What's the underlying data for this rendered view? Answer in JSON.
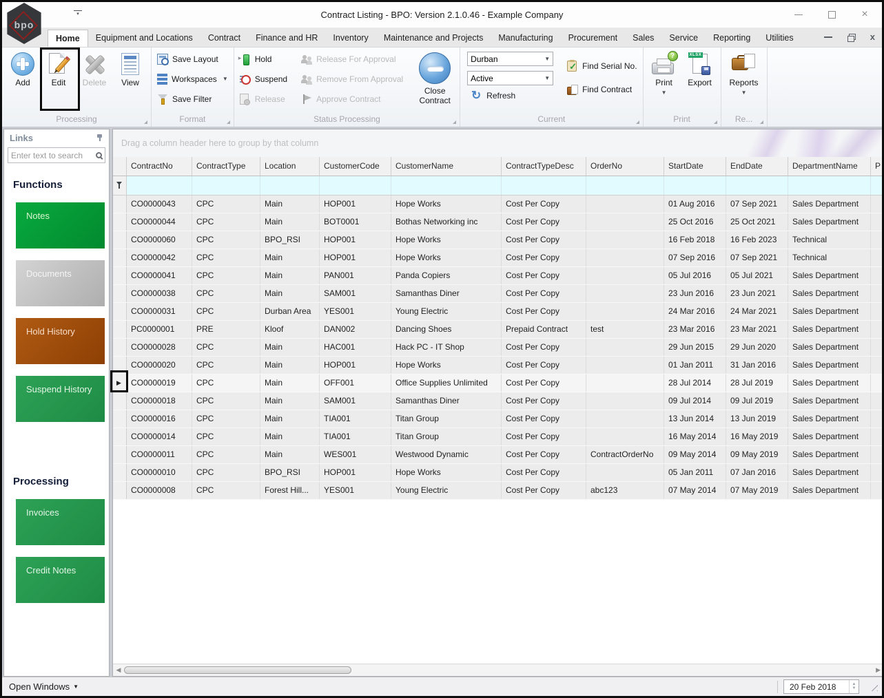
{
  "window": {
    "title": "Contract Listing - BPO: Version 2.1.0.46 - Example Company",
    "logo_text": "bpo"
  },
  "tabs": {
    "items": [
      {
        "label": "Home",
        "active": true
      },
      {
        "label": "Equipment and Locations",
        "active": false
      },
      {
        "label": "Contract",
        "active": false
      },
      {
        "label": "Finance and HR",
        "active": false
      },
      {
        "label": "Inventory",
        "active": false
      },
      {
        "label": "Maintenance and Projects",
        "active": false
      },
      {
        "label": "Manufacturing",
        "active": false
      },
      {
        "label": "Procurement",
        "active": false
      },
      {
        "label": "Sales",
        "active": false
      },
      {
        "label": "Service",
        "active": false
      },
      {
        "label": "Reporting",
        "active": false
      },
      {
        "label": "Utilities",
        "active": false
      }
    ]
  },
  "ribbon": {
    "processing": {
      "label": "Processing",
      "add": "Add",
      "edit": "Edit",
      "delete": "Delete",
      "view": "View"
    },
    "format": {
      "label": "Format",
      "save_layout": "Save Layout",
      "workspaces": "Workspaces",
      "save_filter": "Save Filter"
    },
    "status_processing": {
      "label": "Status Processing",
      "hold": "Hold",
      "suspend": "Suspend",
      "release": "Release",
      "release_for_approval": "Release For Approval",
      "remove_from_approval": "Remove From Approval",
      "approve_contract": "Approve Contract",
      "close_contract": "Close Contract"
    },
    "current": {
      "label": "Current",
      "site_selected": "Durban",
      "status_selected": "Active",
      "refresh": "Refresh",
      "find_serial": "Find Serial No.",
      "find_contract": "Find Contract"
    },
    "print": {
      "label": "Print",
      "print": "Print",
      "export": "Export"
    },
    "reports": {
      "label": "Re...",
      "reports": "Reports"
    }
  },
  "sidebar": {
    "title": "Links",
    "search_placeholder": "Enter text to search",
    "sections": [
      {
        "heading": "Functions",
        "buttons": [
          {
            "label": "Notes",
            "style": "green"
          },
          {
            "label": "Documents",
            "style": "gray"
          },
          {
            "label": "Hold History",
            "style": "rust"
          },
          {
            "label": "Suspend History",
            "style": "green2"
          }
        ]
      },
      {
        "heading": "Processing",
        "buttons": [
          {
            "label": "Invoices",
            "style": "green2"
          },
          {
            "label": "Credit Notes",
            "style": "green2"
          }
        ]
      }
    ]
  },
  "grid": {
    "group_hint": "Drag a column header here to group by that column",
    "focused_contract": "CO0000019",
    "columns": [
      {
        "key": "contract_no",
        "label": "ContractNo"
      },
      {
        "key": "contract_type",
        "label": "ContractType"
      },
      {
        "key": "location",
        "label": "Location"
      },
      {
        "key": "customer_code",
        "label": "CustomerCode"
      },
      {
        "key": "customer_name",
        "label": "CustomerName"
      },
      {
        "key": "contract_type_desc",
        "label": "ContractTypeDesc"
      },
      {
        "key": "order_no",
        "label": "OrderNo"
      },
      {
        "key": "start_date",
        "label": "StartDate"
      },
      {
        "key": "end_date",
        "label": "EndDate"
      },
      {
        "key": "department_name",
        "label": "DepartmentName"
      },
      {
        "key": "partial",
        "label": "P"
      }
    ],
    "rows": [
      {
        "contract_no": "CO0000043",
        "contract_type": "CPC",
        "location": "Main",
        "customer_code": "HOP001",
        "customer_name": "Hope Works",
        "contract_type_desc": "Cost Per Copy",
        "order_no": "",
        "start_date": "01 Aug 2016",
        "end_date": "07 Sep 2021",
        "department_name": "Sales Department"
      },
      {
        "contract_no": "CO0000044",
        "contract_type": "CPC",
        "location": "Main",
        "customer_code": "BOT0001",
        "customer_name": "Bothas Networking inc",
        "contract_type_desc": "Cost Per Copy",
        "order_no": "",
        "start_date": "25 Oct 2016",
        "end_date": "25 Oct 2021",
        "department_name": "Sales Department"
      },
      {
        "contract_no": "CO0000060",
        "contract_type": "CPC",
        "location": "BPO_RSI",
        "customer_code": "HOP001",
        "customer_name": "Hope Works",
        "contract_type_desc": "Cost Per Copy",
        "order_no": "",
        "start_date": "16 Feb 2018",
        "end_date": "16 Feb 2023",
        "department_name": "Technical"
      },
      {
        "contract_no": "CO0000042",
        "contract_type": "CPC",
        "location": "Main",
        "customer_code": "HOP001",
        "customer_name": "Hope Works",
        "contract_type_desc": "Cost Per Copy",
        "order_no": "",
        "start_date": "07 Sep 2016",
        "end_date": "07 Sep 2021",
        "department_name": "Technical"
      },
      {
        "contract_no": "CO0000041",
        "contract_type": "CPC",
        "location": "Main",
        "customer_code": "PAN001",
        "customer_name": "Panda Copiers",
        "contract_type_desc": "Cost Per Copy",
        "order_no": "",
        "start_date": "05 Jul 2016",
        "end_date": "05 Jul 2021",
        "department_name": "Sales Department"
      },
      {
        "contract_no": "CO0000038",
        "contract_type": "CPC",
        "location": "Main",
        "customer_code": "SAM001",
        "customer_name": "Samanthas Diner",
        "contract_type_desc": "Cost Per Copy",
        "order_no": "",
        "start_date": "23 Jun 2016",
        "end_date": "23 Jun 2021",
        "department_name": "Sales Department"
      },
      {
        "contract_no": "CO0000031",
        "contract_type": "CPC",
        "location": "Durban Area",
        "customer_code": "YES001",
        "customer_name": "Young Electric",
        "contract_type_desc": "Cost Per Copy",
        "order_no": "",
        "start_date": "24 Mar 2016",
        "end_date": "24 Mar 2021",
        "department_name": "Sales Department"
      },
      {
        "contract_no": "PC0000001",
        "contract_type": "PRE",
        "location": "Kloof",
        "customer_code": "DAN002",
        "customer_name": "Dancing Shoes",
        "contract_type_desc": "Prepaid Contract",
        "order_no": "test",
        "start_date": "23 Mar 2016",
        "end_date": "23 Mar 2021",
        "department_name": "Sales Department"
      },
      {
        "contract_no": "CO0000028",
        "contract_type": "CPC",
        "location": "Main",
        "customer_code": "HAC001",
        "customer_name": "Hack PC - IT Shop",
        "contract_type_desc": "Cost Per Copy",
        "order_no": "",
        "start_date": "29 Jun 2015",
        "end_date": "29 Jun 2020",
        "department_name": "Sales Department"
      },
      {
        "contract_no": "CO0000020",
        "contract_type": "CPC",
        "location": "Main",
        "customer_code": "HOP001",
        "customer_name": "Hope Works",
        "contract_type_desc": "Cost Per Copy",
        "order_no": "",
        "start_date": "01 Jan 2011",
        "end_date": "31 Jan 2016",
        "department_name": "Sales Department"
      },
      {
        "contract_no": "CO0000019",
        "contract_type": "CPC",
        "location": "Main",
        "customer_code": "OFF001",
        "customer_name": "Office Supplies Unlimited",
        "contract_type_desc": "Cost Per Copy",
        "order_no": "",
        "start_date": "28 Jul 2014",
        "end_date": "28 Jul 2019",
        "department_name": "Sales Department"
      },
      {
        "contract_no": "CO0000018",
        "contract_type": "CPC",
        "location": "Main",
        "customer_code": "SAM001",
        "customer_name": "Samanthas Diner",
        "contract_type_desc": "Cost Per Copy",
        "order_no": "",
        "start_date": "09 Jul 2014",
        "end_date": "09 Jul 2019",
        "department_name": "Sales Department"
      },
      {
        "contract_no": "CO0000016",
        "contract_type": "CPC",
        "location": "Main",
        "customer_code": "TIA001",
        "customer_name": "Titan Group",
        "contract_type_desc": "Cost Per Copy",
        "order_no": "",
        "start_date": "13 Jun 2014",
        "end_date": "13 Jun 2019",
        "department_name": "Sales Department"
      },
      {
        "contract_no": "CO0000014",
        "contract_type": "CPC",
        "location": "Main",
        "customer_code": "TIA001",
        "customer_name": "Titan Group",
        "contract_type_desc": "Cost Per Copy",
        "order_no": "",
        "start_date": "16 May 2014",
        "end_date": "16 May 2019",
        "department_name": "Sales Department"
      },
      {
        "contract_no": "CO0000011",
        "contract_type": "CPC",
        "location": "Main",
        "customer_code": "WES001",
        "customer_name": "Westwood Dynamic",
        "contract_type_desc": "Cost Per Copy",
        "order_no": "ContractOrderNo",
        "start_date": "09 May 2014",
        "end_date": "09 May 2019",
        "department_name": "Sales Department"
      },
      {
        "contract_no": "CO0000010",
        "contract_type": "CPC",
        "location": "BPO_RSI",
        "customer_code": "HOP001",
        "customer_name": "Hope Works",
        "contract_type_desc": "Cost Per Copy",
        "order_no": "",
        "start_date": "05 Jan 2011",
        "end_date": "07 Jan 2016",
        "department_name": "Sales Department"
      },
      {
        "contract_no": "CO0000008",
        "contract_type": "CPC",
        "location": "Forest Hill...",
        "customer_code": "YES001",
        "customer_name": "Young Electric",
        "contract_type_desc": "Cost Per Copy",
        "order_no": "abc123",
        "start_date": "07 May 2014",
        "end_date": "07 May 2019",
        "department_name": "Sales Department"
      }
    ]
  },
  "statusbar": {
    "open_windows": "Open Windows",
    "date": "20 Feb 2018"
  },
  "colors": {
    "sidebar_green": "#08a93e",
    "sidebar_gray": "#bdbdbd",
    "sidebar_rust": "#9d4a0b",
    "sidebar_green2": "#259a4e",
    "filter_row": "#e2fbfe",
    "annotation": "#0a0a0a"
  }
}
